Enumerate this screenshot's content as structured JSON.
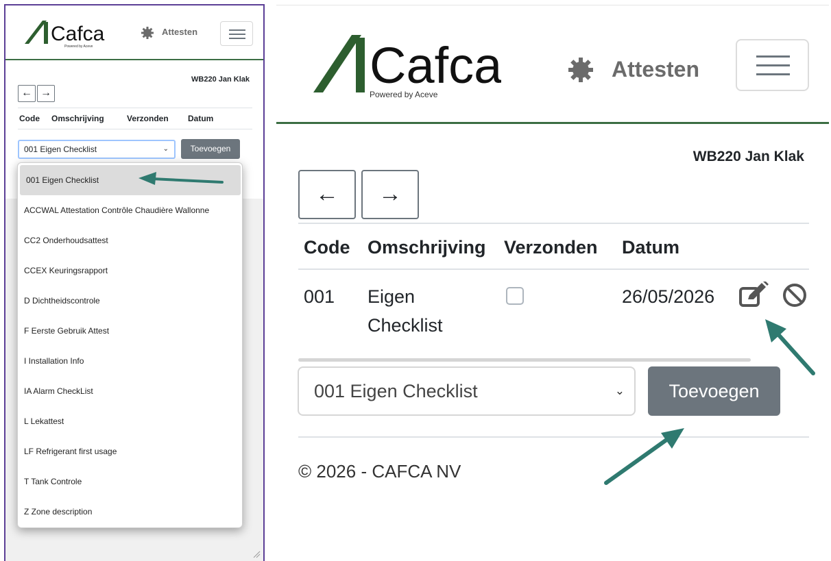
{
  "brand": {
    "logo_text": "Cafca",
    "logo_subtext": "Powered by Aceve",
    "logo_color": "#2d5e2f",
    "header_border_color": "#3c6e43"
  },
  "header": {
    "section_label": "Attesten",
    "section_icon": "gear-icon",
    "menu_icon": "hamburger-menu-icon"
  },
  "user": {
    "label": "WB220 Jan Klak"
  },
  "nav": {
    "back_symbol": "←",
    "forward_symbol": "→"
  },
  "table": {
    "columns": [
      "Code",
      "Omschrijving",
      "Verzonden",
      "Datum"
    ],
    "rows": [
      {
        "code": "001",
        "omschrijving_line1": "Eigen",
        "omschrijving_line2": "Checklist",
        "verzonden": false,
        "datum": "26/05/2026"
      }
    ]
  },
  "add_form": {
    "selected_option": "001 Eigen Checklist",
    "add_button_label": "Toevoegen",
    "options": [
      "001 Eigen Checklist",
      "ACCWAL Attestation Contrôle Chaudière Wallonne",
      "CC2 Onderhoudsattest",
      "CCEX Keuringsrapport",
      "D Dichtheidscontrole",
      "F Eerste Gebruik Attest",
      "I Installation Info",
      "IA Alarm CheckList",
      "L Lekattest",
      "LF Refrigerant first usage",
      "T Tank Controle",
      "Z Zone description"
    ]
  },
  "footer": {
    "copyright": "© 2026 - CAFCA NV"
  },
  "colors": {
    "button_grey": "#6c757d",
    "annotation_arrow": "#2f7a70",
    "panel_border": "#5b3e96"
  }
}
